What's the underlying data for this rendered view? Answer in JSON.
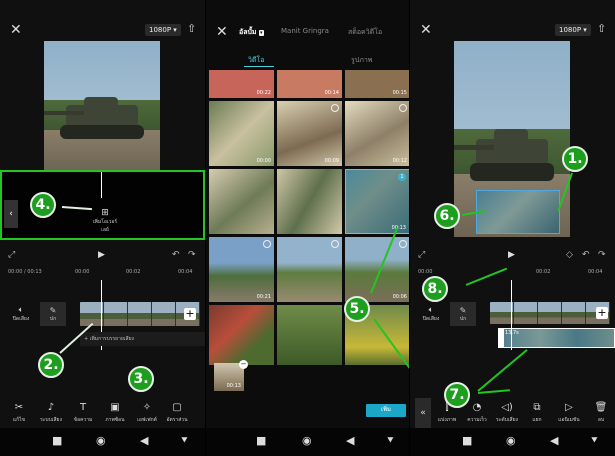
{
  "panel1": {
    "resolution": "1080P",
    "add_item_label": "เพิ่มโอเวอร์เลย์",
    "time_current": "00:00",
    "time_total": "00:13",
    "ticks": [
      "00:00",
      "00:02",
      "00:04"
    ],
    "audio_label": "ปิดเสียง",
    "cover_label": "ปก",
    "add_audio_label": "+ เพิ่มการบรรยายเสียง",
    "toolbar": [
      "แก้ไข",
      "ระบบเสียง",
      "ข้อความ",
      "ภาพซ้อน",
      "เอฟเฟกต์",
      "อัตราส่วน"
    ]
  },
  "panel2": {
    "top_tabs": [
      "อัลบั้ม",
      "Manit Gringra",
      "สต็อควิดีโอ"
    ],
    "mid_tabs": [
      "วิดีโอ",
      "รูปภาพ"
    ],
    "durations": [
      "00:22",
      "00:14",
      "00:15",
      "00:00",
      "00:09",
      "00:12",
      "00:13",
      "00:21",
      "00:06",
      "00:13"
    ],
    "selected_index": "1",
    "add_button": "เพิ่ม"
  },
  "panel3": {
    "resolution": "1080P",
    "time_current": "00:00",
    "ticks": [
      "00:02",
      "00:04"
    ],
    "audio_label": "ปิดเสียง",
    "cover_label": "ปก",
    "overlay_clip_label": "13.7s",
    "toolbar": [
      "แบ่งภาพ",
      "ความเร็ว",
      "ระดับเสียง",
      "แยก",
      "แอนิเมชัน",
      "ลบ"
    ]
  },
  "annotations": [
    "1.",
    "2.",
    "3.",
    "4.",
    "5.",
    "6.",
    "7.",
    "8."
  ],
  "colors": {
    "annotation_green": "#1e9e1e",
    "accent_cyan": "#4fd0e0",
    "confirm_blue": "#1ba8c8"
  }
}
